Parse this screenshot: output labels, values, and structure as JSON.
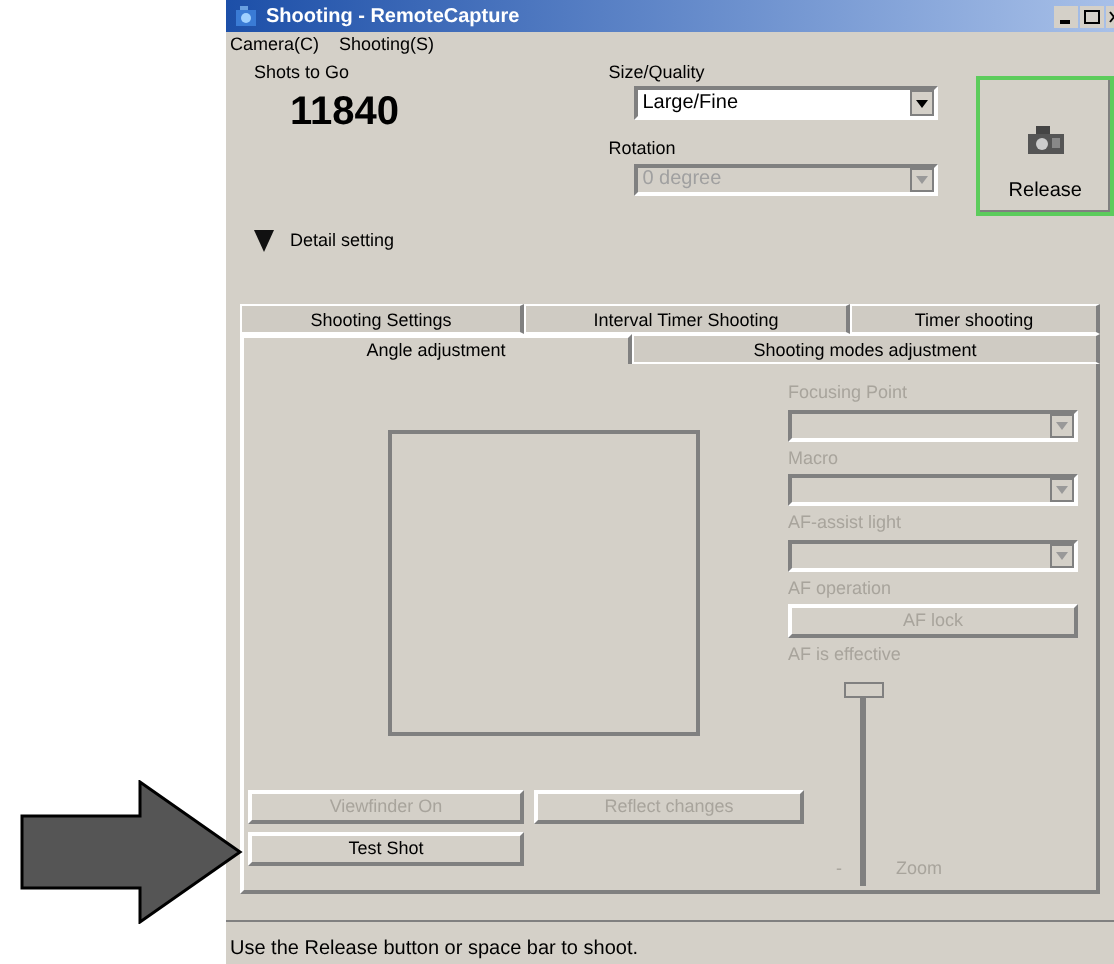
{
  "window": {
    "title": "Shooting - RemoteCapture"
  },
  "menu": [
    "Camera(C)",
    "Shooting(S)"
  ],
  "shots_to_go": {
    "label": "Shots to Go",
    "value": "11840"
  },
  "size_quality": {
    "label": "Size/Quality",
    "value": "Large/Fine",
    "disabled": false
  },
  "rotation": {
    "label": "Rotation",
    "value": "0 degree",
    "disabled": true
  },
  "release_button": {
    "label": "Release"
  },
  "detail_setting": {
    "label": "Detail setting"
  },
  "tab_rows": [
    [
      {
        "label": "Shooting Settings",
        "selected": false
      },
      {
        "label": "Interval Timer Shooting",
        "selected": false
      },
      {
        "label": "Timer shooting",
        "selected": false
      }
    ],
    [
      {
        "label": "Angle adjustment",
        "selected": true
      },
      {
        "label": "Shooting modes adjustment",
        "selected": false
      }
    ]
  ],
  "focus_controls": [
    {
      "kind": "dropdown",
      "label": "Focusing Point",
      "disabled": true
    },
    {
      "kind": "dropdown",
      "label": "Macro",
      "disabled": true
    },
    {
      "kind": "dropdown",
      "label": "AF-assist light",
      "disabled": true
    },
    {
      "kind": "button",
      "label": "AF operation",
      "button": "AF lock",
      "disabled": true
    }
  ],
  "af_status": "AF is effective",
  "zoom": {
    "label": "Zoom",
    "min_mark": "-",
    "level": 1,
    "disabled": true
  },
  "buttons": [
    {
      "label": "Viewfinder On",
      "disabled": true
    },
    {
      "label": "Reflect changes",
      "disabled": true
    },
    {
      "label": "Test Shot",
      "disabled": false
    }
  ],
  "status_bar": "Use the Release button or space bar to shoot."
}
